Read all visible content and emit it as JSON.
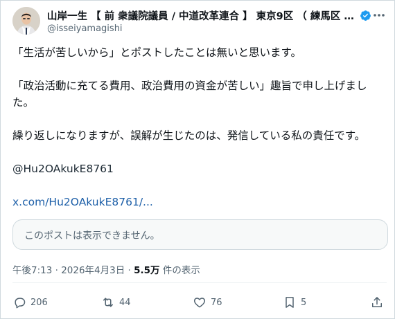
{
  "author": {
    "display_name": "山岸一生 【 前 衆議院議員 / 中道改革連合 】 東京9区 （ 練馬区 西...",
    "handle": "@isseiyamagishi"
  },
  "post": {
    "p1": "「生活が苦しいから」とポストしたことは無いと思います。",
    "p2": "「政治活動に充てる費用、政治費用の資金が苦しい」趣旨で申し上げました。",
    "p3": "繰り返しになりますが、誤解が生じたのは、発信している私の責任です。",
    "mention": "@Hu2OAkukE8761",
    "link": "x.com/Hu2OAkukE8761/..."
  },
  "quoted_card": {
    "text": "このポストは表示できません。"
  },
  "meta": {
    "time": "午後7:13",
    "separator": " · ",
    "date": "2026年4月3日",
    "views": "5.5万",
    "views_suffix": " 件の表示"
  },
  "actions": {
    "replies": "206",
    "reposts": "44",
    "likes": "76",
    "bookmarks": "5"
  },
  "colors": {
    "verified": "#1d9bf0",
    "muted": "#536471",
    "link": "#1d5fa8"
  }
}
